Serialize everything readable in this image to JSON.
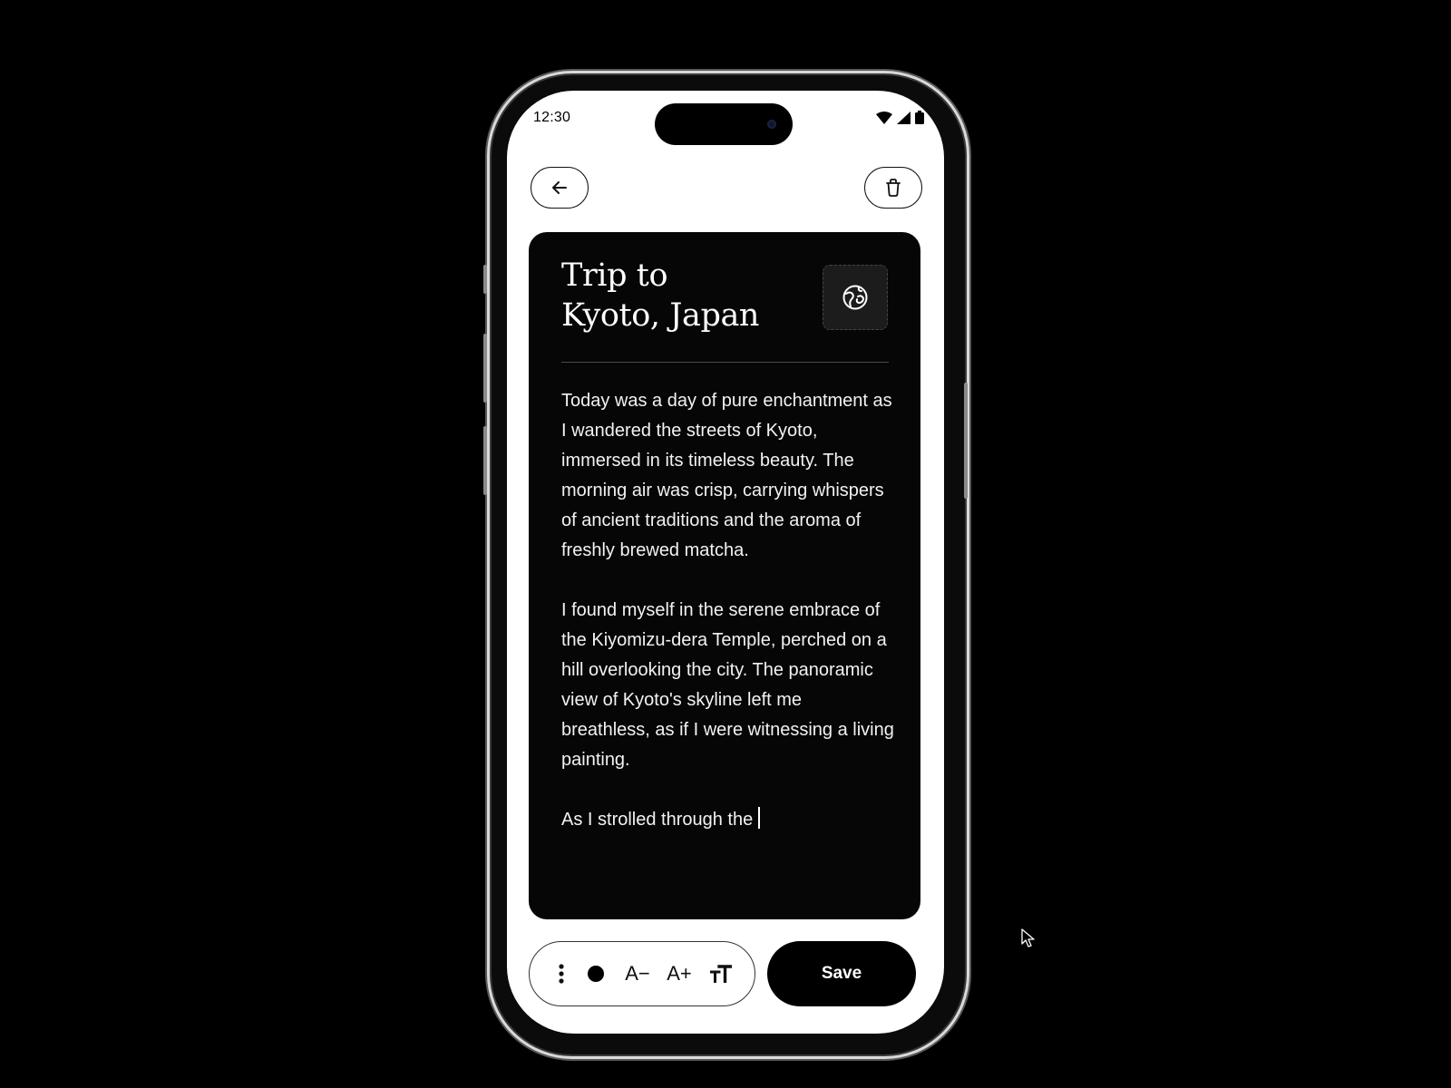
{
  "status_bar": {
    "time": "12:30",
    "icons": [
      "wifi-icon",
      "cellular-signal-icon",
      "battery-icon"
    ]
  },
  "nav": {
    "back_icon": "arrow-left-icon",
    "trash_icon": "trash-icon"
  },
  "note": {
    "title": "Trip to\nKyoto, Japan",
    "globe_icon": "globe-icon",
    "paragraphs": [
      "Today was a day of pure enchantment as I wandered the streets of Kyoto, immersed in its timeless beauty. The morning air was crisp, carrying whispers of ancient traditions and the aroma of freshly brewed matcha.",
      "I found myself in the serene embrace of the Kiyomizu-dera Temple, perched on a hill overlooking the city. The panoramic view of Kyoto's skyline left me breathless, as if I were witnessing a living painting.",
      "As I strolled through the"
    ]
  },
  "toolbar": {
    "more_icon": "more-vertical-icon",
    "color_value": "#000000",
    "decrease_label": "A−",
    "increase_label": "A+",
    "text_size_icon": "text-size-icon"
  },
  "save_label": "Save",
  "colors": {
    "background": "#000000",
    "screen": "#ffffff",
    "card": "#060606",
    "accent": "#000000"
  }
}
